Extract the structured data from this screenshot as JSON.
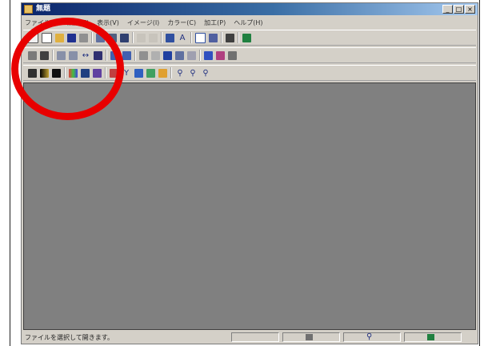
{
  "window": {
    "title": "無題"
  },
  "window_buttons": [
    "_",
    "□",
    "×"
  ],
  "menu": [
    "ファイル(F)",
    "編集(E)",
    "表示(V)",
    "イメージ(I)",
    "カラー(C)",
    "加工(P)",
    "ヘルプ(H)"
  ],
  "toolbar1": [
    "new-window-icon",
    "new-file-icon",
    "open-folder-icon",
    "save-icon",
    "print-icon",
    "sep",
    "copy-icon",
    "paste-icon",
    "send-icon",
    "sep",
    "undo-icon",
    "redo-icon",
    "sep",
    "fit-window-icon",
    "text-icon",
    "sep",
    "grid-icon",
    "palette-icon",
    "sep",
    "eyedropper-icon",
    "sep",
    "color-select-icon"
  ],
  "toolbar2": [
    "crop-icon",
    "resize-icon",
    "sep",
    "rotate-left-icon",
    "rotate-right-icon",
    "flip-horizontal-icon",
    "flip-vertical-icon",
    "sep",
    "rotate-90-icon",
    "rotate-180-icon",
    "sep",
    "filter-icon",
    "brightness-icon",
    "sharpen-icon",
    "blur-icon",
    "emboss-icon",
    "sep",
    "brush-icon",
    "pencil-icon",
    "fill-icon"
  ],
  "toolbar3": [
    "swatch-icon",
    "gradient-icon",
    "mono-icon",
    "sep",
    "rgb-icon",
    "color-balance-icon",
    "channel-icon",
    "sep",
    "histogram-icon",
    "filter-funnel-icon",
    "palette2-icon",
    "mosaic-icon",
    "color-icon",
    "sep",
    "zoom-icon",
    "zoom-in-icon",
    "zoom-out-icon"
  ],
  "colors": {
    "client_bg": "#808080",
    "chrome": "#d4d0c8",
    "annotation": "#e80000"
  },
  "status": {
    "message": "ファイルを選択して開きます。",
    "zoom_icon": "magnifier-icon",
    "color_icon": "color-indicator-icon",
    "doc_icon": "document-icon"
  }
}
